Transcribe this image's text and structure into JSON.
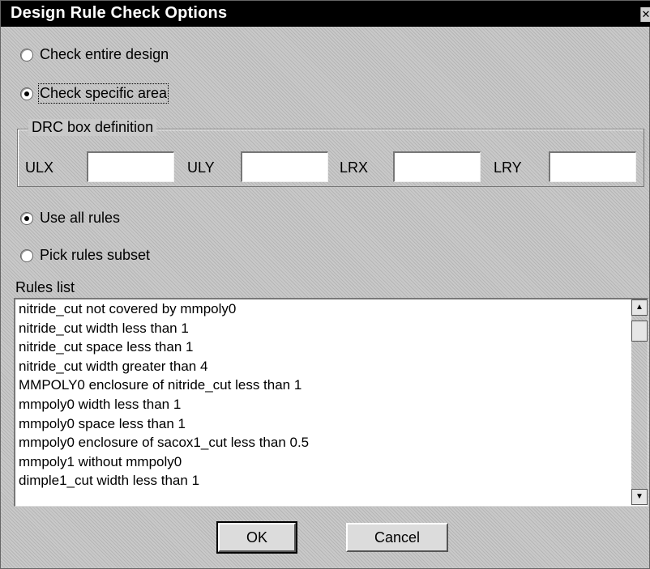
{
  "window": {
    "title": "Design Rule Check Options",
    "close_glyph": "✕"
  },
  "check_scope": {
    "entire": "Check entire design",
    "specific": "Check specific area",
    "selected": "specific"
  },
  "drc_box": {
    "title": "DRC box definition",
    "fields": [
      {
        "label": "ULX",
        "value": ""
      },
      {
        "label": "ULY",
        "value": ""
      },
      {
        "label": "LRX",
        "value": ""
      },
      {
        "label": "LRY",
        "value": ""
      }
    ]
  },
  "rules_mode": {
    "all": "Use all rules",
    "subset": "Pick rules subset",
    "selected": "all"
  },
  "rules_list": {
    "title": "Rules list",
    "items": [
      "nitride_cut not covered by mmpoly0",
      "nitride_cut width less than 1",
      "nitride_cut space less than 1",
      "nitride_cut width greater than 4",
      "MMPOLY0 enclosure of nitride_cut less than 1",
      "mmpoly0 width less than 1",
      "mmpoly0 space less than 1",
      "mmpoly0 enclosure of sacox1_cut less than 0.5",
      "mmpoly1 without mmpoly0",
      "dimple1_cut width less than 1"
    ]
  },
  "buttons": {
    "ok": "OK",
    "cancel": "Cancel"
  },
  "icons": {
    "scroll_up": "up-arrow-icon",
    "scroll_down": "down-arrow-icon"
  }
}
